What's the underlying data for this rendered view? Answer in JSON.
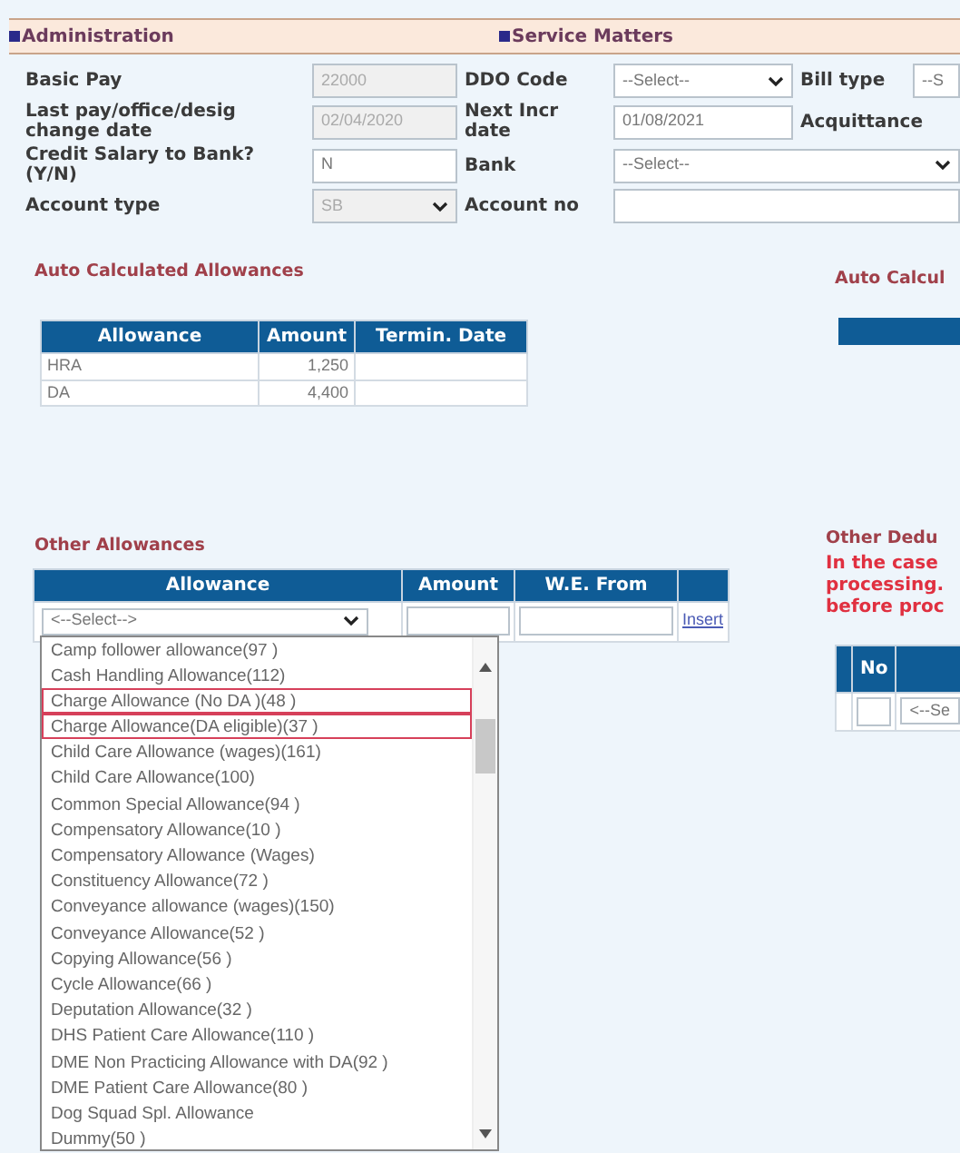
{
  "header_sections": [
    {
      "label": "Administration"
    },
    {
      "label": "Service Matters"
    }
  ],
  "form_rows": [
    {
      "fields": [
        {
          "label": "Basic Pay",
          "kind": "text",
          "value": "22000",
          "disabled": true
        },
        {
          "label": "DDO Code",
          "kind": "select",
          "value": "--Select--",
          "disabled": false
        },
        {
          "label": "Bill type",
          "kind": "select",
          "value": "--S",
          "disabled": false
        }
      ]
    },
    {
      "fields": [
        {
          "label": "Last pay/office/desig change date",
          "kind": "text",
          "value": "02/04/2020",
          "disabled": true
        },
        {
          "label": "Next Incr date",
          "kind": "text",
          "value": "01/08/2021",
          "disabled": false
        },
        {
          "label": "Acquittance",
          "kind": "none"
        }
      ]
    },
    {
      "fields": [
        {
          "label": "Credit Salary to Bank? (Y/N)",
          "kind": "text",
          "value": "N",
          "disabled": false
        },
        {
          "label": "Bank",
          "kind": "select",
          "value": "--Select--",
          "disabled": false,
          "wide": true
        }
      ]
    },
    {
      "fields": [
        {
          "label": "Account type",
          "kind": "select",
          "value": "SB",
          "disabled": true
        },
        {
          "label": "Account no",
          "kind": "text",
          "disabled": false,
          "wide": true
        }
      ]
    }
  ],
  "auto_allowances": {
    "title": "Auto Calculated Allowances",
    "columns": [
      "Allowance",
      "Amount",
      "Termin. Date"
    ],
    "rows": [
      {
        "allowance": "HRA",
        "amount": "1,250"
      },
      {
        "allowance": "DA",
        "amount": "4,400"
      }
    ]
  },
  "other_allowances": {
    "title": "Other Allowances",
    "columns": [
      "Allowance",
      "Amount",
      "W.E. From"
    ],
    "select_value": "<--Select-->",
    "link": "Insert",
    "options": [
      {
        "label": "Camp follower allowance(97 )",
        "highlighted": false
      },
      {
        "label": "Cash Handling Allowance(112)",
        "highlighted": false
      },
      {
        "label": "Charge Allowance (No DA )(48 )",
        "highlighted": true
      },
      {
        "label": "Charge Allowance(DA eligible)(37 )",
        "highlighted": true
      },
      {
        "label": "Child Care Allowance (wages)(161)",
        "highlighted": false
      },
      {
        "label": "Child Care Allowance(100)",
        "highlighted": false
      },
      {
        "label": "Common Special Allowance(94 )",
        "highlighted": false
      },
      {
        "label": "Compensatory Allowance(10 )",
        "highlighted": false
      },
      {
        "label": "Compensatory Allowance (Wages)",
        "highlighted": false
      },
      {
        "label": "Constituency Allowance(72 )",
        "highlighted": false
      },
      {
        "label": "Conveyance allowance (wages)(150)",
        "highlighted": false
      },
      {
        "label": "Conveyance Allowance(52 )",
        "highlighted": false
      },
      {
        "label": "Copying Allowance(56 )",
        "highlighted": false
      },
      {
        "label": "Cycle Allowance(66 )",
        "highlighted": false
      },
      {
        "label": "Deputation Allowance(32 )",
        "highlighted": false
      },
      {
        "label": "DHS Patient Care Allowance(110 )",
        "highlighted": false
      },
      {
        "label": "DME Non Practicing Allowance with DA(92 )",
        "highlighted": false
      },
      {
        "label": "DME Patient Care Allowance(80 )",
        "highlighted": false
      },
      {
        "label": "Dog Squad Spl. Allowance",
        "highlighted": false
      },
      {
        "label": "Dummy(50 )",
        "highlighted": false
      }
    ]
  },
  "right_panel": {
    "auto_title": "Auto Calcul",
    "deductions_title": "Other Dedu",
    "note_lines": [
      "In the case",
      "processing.",
      "before proc"
    ],
    "column": "No",
    "select_value": "<--Se"
  }
}
